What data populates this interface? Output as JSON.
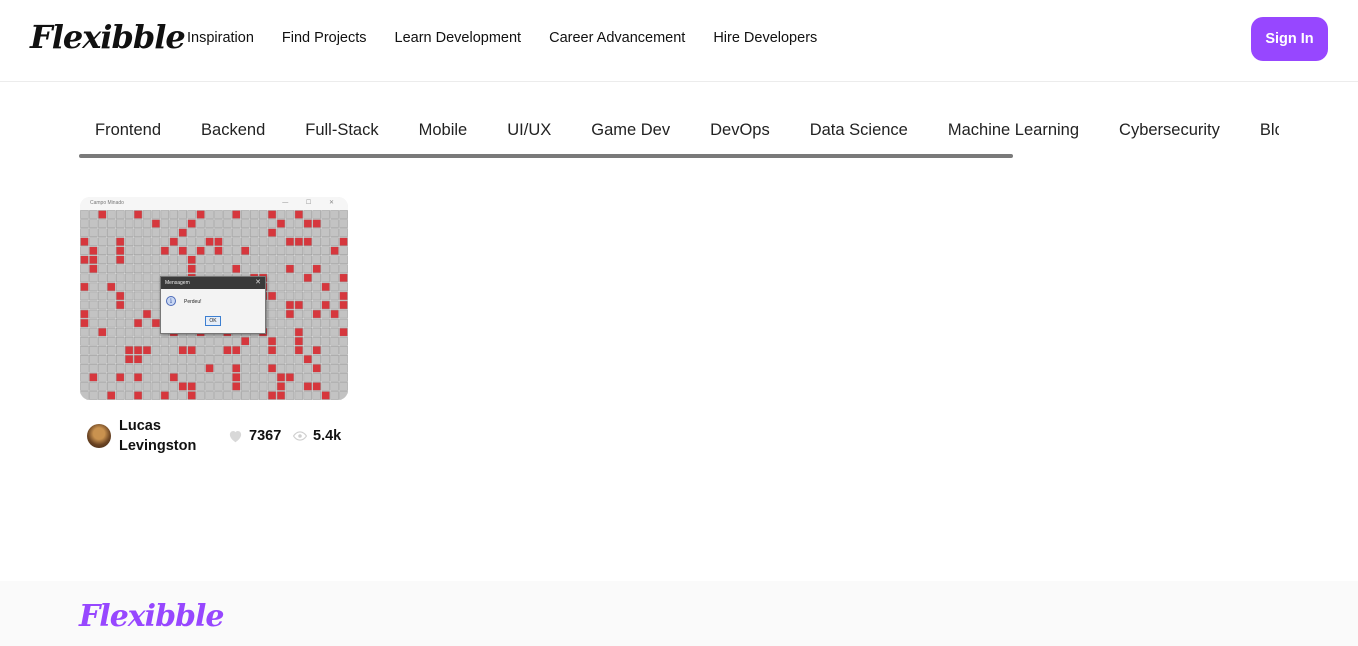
{
  "header": {
    "logo": "Flexibble",
    "nav": [
      "Inspiration",
      "Find Projects",
      "Learn Development",
      "Career Advancement",
      "Hire Developers"
    ],
    "signin_label": "Sign In"
  },
  "categories": [
    "Frontend",
    "Backend",
    "Full-Stack",
    "Mobile",
    "UI/UX",
    "Game Dev",
    "DevOps",
    "Data Science",
    "Machine Learning",
    "Cybersecurity",
    "Blockchain"
  ],
  "project": {
    "window_title": "Campo Minado",
    "window_controls": "— ☐ ✕",
    "dialog_title": "Mensagem",
    "dialog_close": "✕",
    "dialog_icon": "i",
    "dialog_message": "Perdeu!",
    "dialog_button": "OK",
    "author": "Lucas Levingston",
    "likes": "7367",
    "views": "5.4k"
  },
  "footer": {
    "logo": "Flexibble"
  },
  "colors": {
    "accent": "#9747ff",
    "mine": "#d6373d",
    "cell": "#c3c3c3"
  }
}
